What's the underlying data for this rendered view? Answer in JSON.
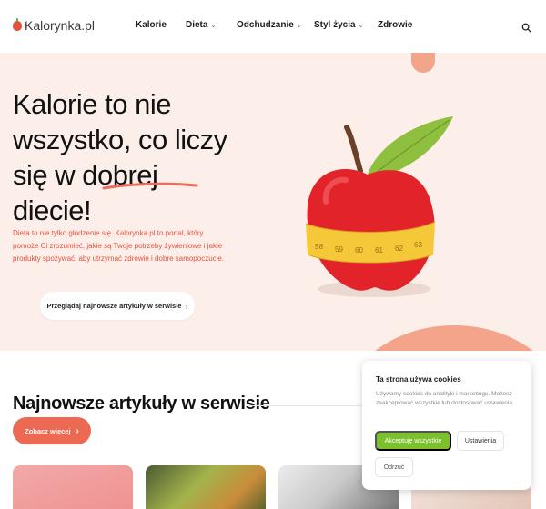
{
  "header": {
    "logo_text": "Kalorynka.pl",
    "nav": [
      {
        "label": "Kalorie",
        "has_dropdown": false
      },
      {
        "label": "Dieta",
        "has_dropdown": true
      },
      {
        "label": "Odchudzanie",
        "has_dropdown": true
      },
      {
        "label": "Styl życia",
        "has_dropdown": true
      },
      {
        "label": "Zdrowie",
        "has_dropdown": false
      }
    ],
    "search_icon": "search-icon"
  },
  "hero": {
    "title_lines": [
      "Kalorie to nie",
      "wszystko, co liczy",
      "się w dobrej",
      "diecie!"
    ],
    "description": "Dieta to nie tylko głodzenie się. Kalorynka.pl to portal, który pomoże Ci zrozumieć, jakie są Twoje potrzeby żywieniowe i jakie produkty spożywać, aby utrzymać zdrowie i dobre samopoczucie.",
    "cta_label": "Przeglądaj najnowsze artykuły w serwisie",
    "cta_icon": "chevron-right-icon",
    "tape_numbers": [
      "58",
      "59",
      "60",
      "61",
      "62",
      "63"
    ]
  },
  "articles": {
    "title": "Najnowsze artykuły w serwisie",
    "more_label": "Zobacz więcej",
    "more_icon": "chevron-right-icon"
  },
  "cookie_banner": {
    "title": "Ta strona używa cookies",
    "text": "Używamy cookies do analityki i marketingu. Możesz zaakceptować wszystkie lub dostosować ustawienia.",
    "accept_label": "Akceptuję wszystkie",
    "settings_label": "Ustawienia",
    "reject_label": "Odrzuć"
  },
  "colors": {
    "accent": "#e8503e",
    "hero_bg": "#fcefe9",
    "accept_green": "#7cc02e",
    "cta_coral": "#ec6a54"
  }
}
